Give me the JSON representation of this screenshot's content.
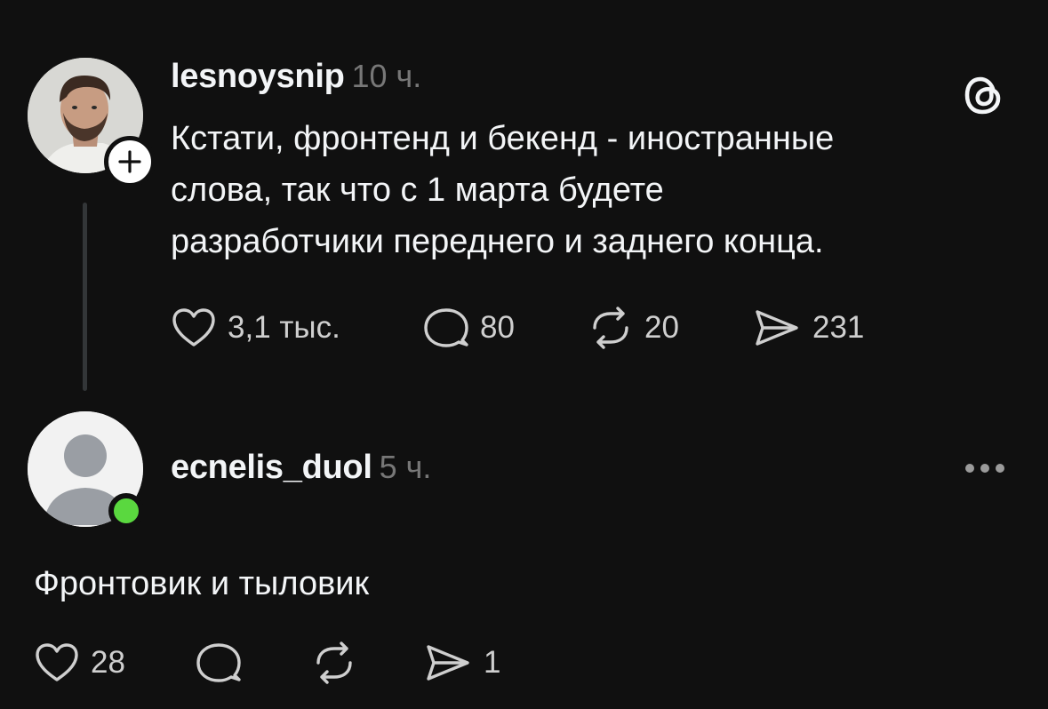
{
  "post": {
    "username": "lesnoysnip",
    "time": "10 ч.",
    "text": "Кстати, фронтенд и бекенд - иностранные слова, так что с 1 марта будете разработчики переднего и заднего конца.",
    "text_lines": [
      "Кстати, фронтенд и бекенд - иностранные",
      "слова, так что с 1 марта будете",
      "разработчики переднего и заднего конца."
    ],
    "likes": "3,1 тыс.",
    "replies": "80",
    "reposts": "20",
    "shares": "231",
    "logo_icon": "threads-logo-icon",
    "follow_icon": "plus-icon"
  },
  "reply": {
    "username": "ecnelis_duol",
    "time": "5 ч.",
    "text": "Фронтовик и тыловик",
    "likes": "28",
    "shares": "1",
    "more_icon": "more-icon",
    "status_color": "#5ad83f"
  },
  "colors": {
    "background": "#101010",
    "text": "#f3f5f7",
    "muted": "#777777"
  }
}
